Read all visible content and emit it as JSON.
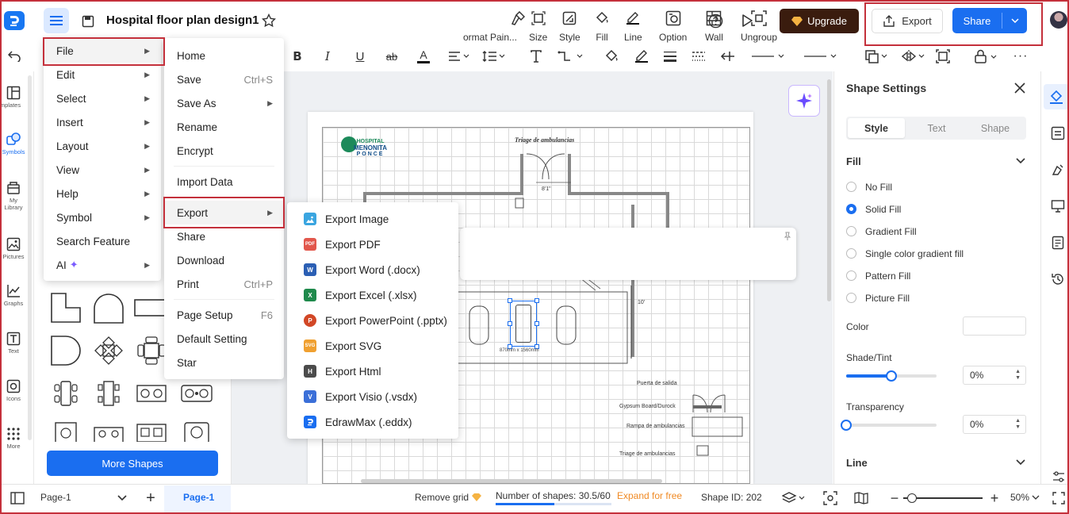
{
  "app": {
    "title": "Hospital floor plan design1"
  },
  "header": {
    "upgrade_label": "Upgrade",
    "export_label": "Export",
    "share_label": "Share"
  },
  "rail": {
    "items": [
      {
        "label": "Templates",
        "icon": "templates-icon"
      },
      {
        "label": "Symbols",
        "icon": "symbols-icon"
      },
      {
        "label": "My Library",
        "icon": "library-icon"
      },
      {
        "label": "Pictures",
        "icon": "pictures-icon"
      },
      {
        "label": "Graphs",
        "icon": "graphs-icon"
      },
      {
        "label": "Text",
        "icon": "text-icon"
      },
      {
        "label": "Icons",
        "icon": "icons-icon"
      },
      {
        "label": "More",
        "icon": "more-icon"
      }
    ]
  },
  "library": {
    "more_shapes_label": "More Shapes"
  },
  "file_menu": {
    "items": [
      {
        "label": "File"
      },
      {
        "label": "Edit"
      },
      {
        "label": "Select"
      },
      {
        "label": "Insert"
      },
      {
        "label": "Layout"
      },
      {
        "label": "View"
      },
      {
        "label": "Help"
      },
      {
        "label": "Symbol"
      },
      {
        "label": "Search Feature"
      },
      {
        "label": "AI"
      }
    ]
  },
  "file_submenu": {
    "items": [
      {
        "label": "Home",
        "shortcut": ""
      },
      {
        "label": "Save",
        "shortcut": "Ctrl+S"
      },
      {
        "label": "Save As",
        "shortcut": ""
      },
      {
        "label": "Rename",
        "shortcut": ""
      },
      {
        "label": "Encrypt",
        "shortcut": ""
      },
      {
        "label": "Import Data",
        "shortcut": ""
      },
      {
        "label": "Export",
        "shortcut": ""
      },
      {
        "label": "Share",
        "shortcut": ""
      },
      {
        "label": "Download",
        "shortcut": ""
      },
      {
        "label": "Print",
        "shortcut": "Ctrl+P"
      },
      {
        "label": "Page Setup",
        "shortcut": "F6"
      },
      {
        "label": "Default Setting",
        "shortcut": ""
      },
      {
        "label": "Star",
        "shortcut": ""
      }
    ]
  },
  "export_menu": {
    "items": [
      {
        "label": "Export Image",
        "badge": "",
        "color": "#3aa5e0"
      },
      {
        "label": "Export PDF",
        "badge": "PDF",
        "color": "#e2574c"
      },
      {
        "label": "Export Word (.docx)",
        "badge": "W",
        "color": "#2b5fb4"
      },
      {
        "label": "Export Excel (.xlsx)",
        "badge": "X",
        "color": "#1f8a4c"
      },
      {
        "label": "Export PowerPoint (.pptx)",
        "badge": "P",
        "color": "#d24726"
      },
      {
        "label": "Export SVG",
        "badge": "SVG",
        "color": "#f0a030"
      },
      {
        "label": "Export Html",
        "badge": "H",
        "color": "#4b4b4b"
      },
      {
        "label": "Export Visio (.vsdx)",
        "badge": "V",
        "color": "#3b6fd8"
      },
      {
        "label": "EdrawMax (.eddx)",
        "badge": "",
        "color": "#1a6ef0"
      }
    ]
  },
  "float_toolbar": {
    "items": [
      {
        "label": "ormat Pain..."
      },
      {
        "label": "Size"
      },
      {
        "label": "Style"
      },
      {
        "label": "Fill"
      },
      {
        "label": "Line"
      },
      {
        "label": "Option"
      },
      {
        "label": "Wall"
      },
      {
        "label": "Ungroup"
      }
    ]
  },
  "floorplan": {
    "brand_line1": "HOSPITAL",
    "brand_line2": "MENONITA",
    "brand_line3": "PONCE",
    "title": "Triage de ambulancias",
    "dim_top": "8'1\"",
    "dim_side": "10'",
    "dim_selected": "870mm x 1560mm",
    "legend": [
      "Puerta de salida",
      "Gypsum Board/Durock",
      "Rampa de ambulancias",
      "Triage de ambulancias"
    ]
  },
  "shape_settings": {
    "title": "Shape Settings",
    "tabs": [
      "Style",
      "Text",
      "Shape"
    ],
    "fill_title": "Fill",
    "fill_options": [
      "No Fill",
      "Solid Fill",
      "Gradient Fill",
      "Single color gradient fill",
      "Pattern Fill",
      "Picture Fill"
    ],
    "selected_fill_index": 1,
    "color_label": "Color",
    "shade_label": "Shade/Tint",
    "shade_value": "0%",
    "shade_level": 0.5,
    "transparency_label": "Transparency",
    "transparency_value": "0%",
    "line_title": "Line"
  },
  "status": {
    "page_select": "Page-1",
    "page_tab": "Page-1",
    "remove_grid": "Remove grid",
    "shape_count": "Number of shapes: 30.5/60",
    "shape_usage": 0.51,
    "expand": "Expand for free",
    "shape_id": "Shape ID: 202",
    "zoom": "50%"
  }
}
